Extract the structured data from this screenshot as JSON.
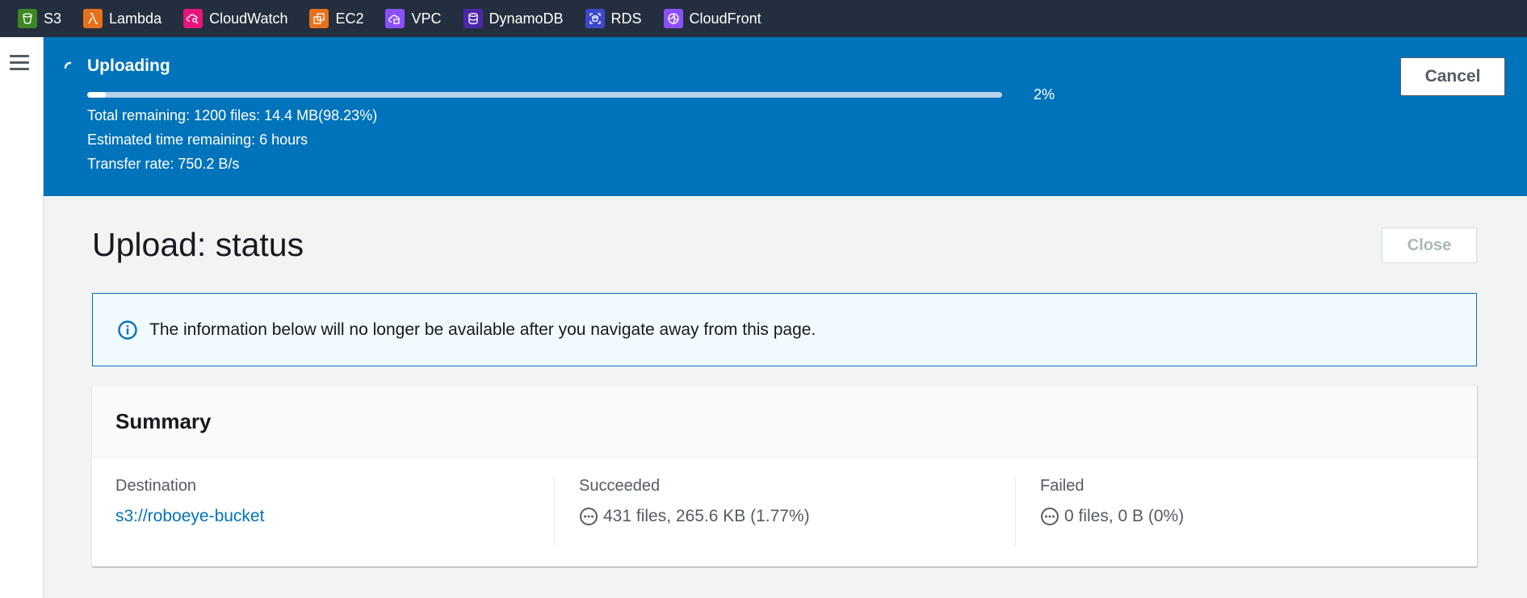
{
  "services": [
    {
      "label": "S3",
      "icon": "s3-icon",
      "color": "#3f8624"
    },
    {
      "label": "Lambda",
      "icon": "lambda-icon",
      "color": "#e7711b"
    },
    {
      "label": "CloudWatch",
      "icon": "cloudwatch-icon",
      "color": "#e7157b"
    },
    {
      "label": "EC2",
      "icon": "ec2-icon",
      "color": "#e7711b"
    },
    {
      "label": "VPC",
      "icon": "vpc-icon",
      "color": "#8c4fff"
    },
    {
      "label": "DynamoDB",
      "icon": "dynamodb-icon",
      "color": "#4d27aa"
    },
    {
      "label": "RDS",
      "icon": "rds-icon",
      "color": "#3b48cc"
    },
    {
      "label": "CloudFront",
      "icon": "cloudfront-icon",
      "color": "#8c4fff"
    }
  ],
  "upload_flash": {
    "title": "Uploading",
    "progress_percent": 2,
    "progress_label": "2%",
    "total_remaining": "Total remaining: 1200 files: 14.4 MB(98.23%)",
    "time_remaining": "Estimated time remaining: 6 hours",
    "transfer_rate": "Transfer rate: 750.2 B/s",
    "cancel_label": "Cancel",
    "background_color": "#0073bb"
  },
  "page": {
    "title": "Upload: status",
    "close_label": "Close"
  },
  "info_alert": {
    "text": "The information below will no longer be available after you navigate away from this page."
  },
  "summary": {
    "title": "Summary",
    "destination_label": "Destination",
    "destination_value": "s3://roboeye-bucket",
    "succeeded_label": "Succeeded",
    "succeeded_value": "431 files, 265.6 KB (1.77%)",
    "failed_label": "Failed",
    "failed_value": "0 files, 0 B (0%)"
  }
}
